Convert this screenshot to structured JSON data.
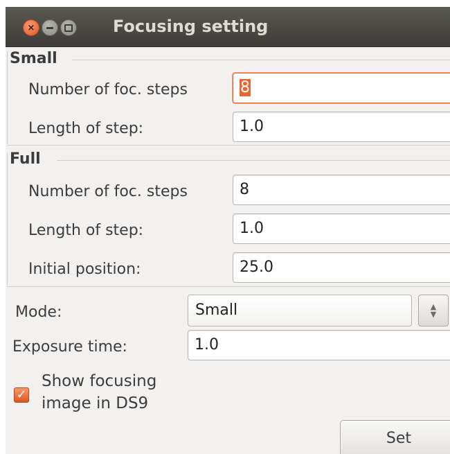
{
  "window": {
    "title": "Focusing setting"
  },
  "small": {
    "label": "Small",
    "steps_label": "Number of foc. steps",
    "steps_value": "8",
    "length_label": "Length of step:",
    "length_value": "1.0"
  },
  "full": {
    "label": "Full",
    "steps_label": "Number of foc. steps",
    "steps_value": "8",
    "length_label": "Length of step:",
    "length_value": "1.0",
    "initial_label": "Initial position:",
    "initial_value": "25.0"
  },
  "mode": {
    "label": "Mode:",
    "value": "Small"
  },
  "exposure": {
    "label": "Exposure time:",
    "value": "1.0"
  },
  "ds9_checkbox": {
    "label": "Show focusing image in DS9",
    "checked": true
  },
  "set_button": {
    "label": "Set"
  },
  "colors": {
    "accent": "#e8662e",
    "titlebar": "#3d3c38",
    "background": "#f2f1f0"
  }
}
